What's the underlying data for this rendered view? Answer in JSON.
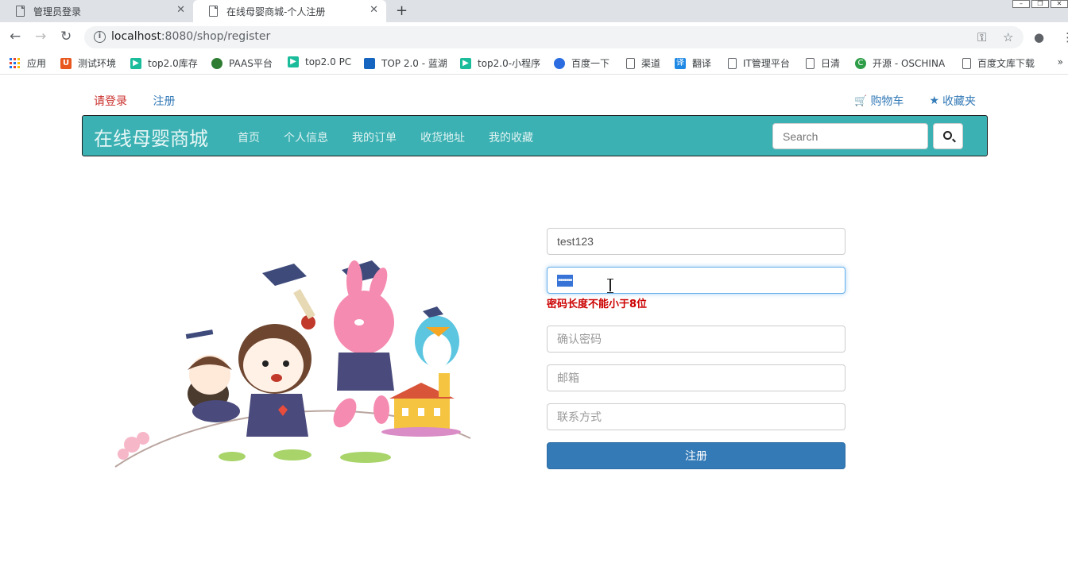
{
  "browser": {
    "tabs": [
      {
        "label": "管理员登录"
      },
      {
        "label": "在线母婴商城-个人注册"
      }
    ],
    "url_host": "localhost",
    "url_rest": ":8080/shop/register",
    "bookmarks": [
      "应用",
      "测试环境",
      "top2.0库存",
      "PAAS平台",
      "top2.0 PC",
      "TOP 2.0 - 蓝湖",
      "top2.0-小程序",
      "百度一下",
      "渠道",
      "翻译",
      "IT管理平台",
      "日清",
      "开源 - OSCHINA",
      "百度文库下载"
    ]
  },
  "header": {
    "login_link": "请登录",
    "register_link": "注册",
    "cart_link": "购物车",
    "favorites_link": "收藏夹"
  },
  "navbar": {
    "brand": "在线母婴商城",
    "items": [
      "首页",
      "个人信息",
      "我的订单",
      "收货地址",
      "我的收藏"
    ],
    "search_placeholder": "Search"
  },
  "form": {
    "username_value": "test123",
    "password_mask": "•••••••",
    "password_error": "密码长度不能小于8位",
    "confirm_placeholder": "确认密码",
    "email_placeholder": "邮箱",
    "contact_placeholder": "联系方式",
    "submit_label": "注册"
  },
  "colors": {
    "navbar": "#3bb1b3",
    "primary": "#337ab7",
    "danger": "#c9302c"
  }
}
